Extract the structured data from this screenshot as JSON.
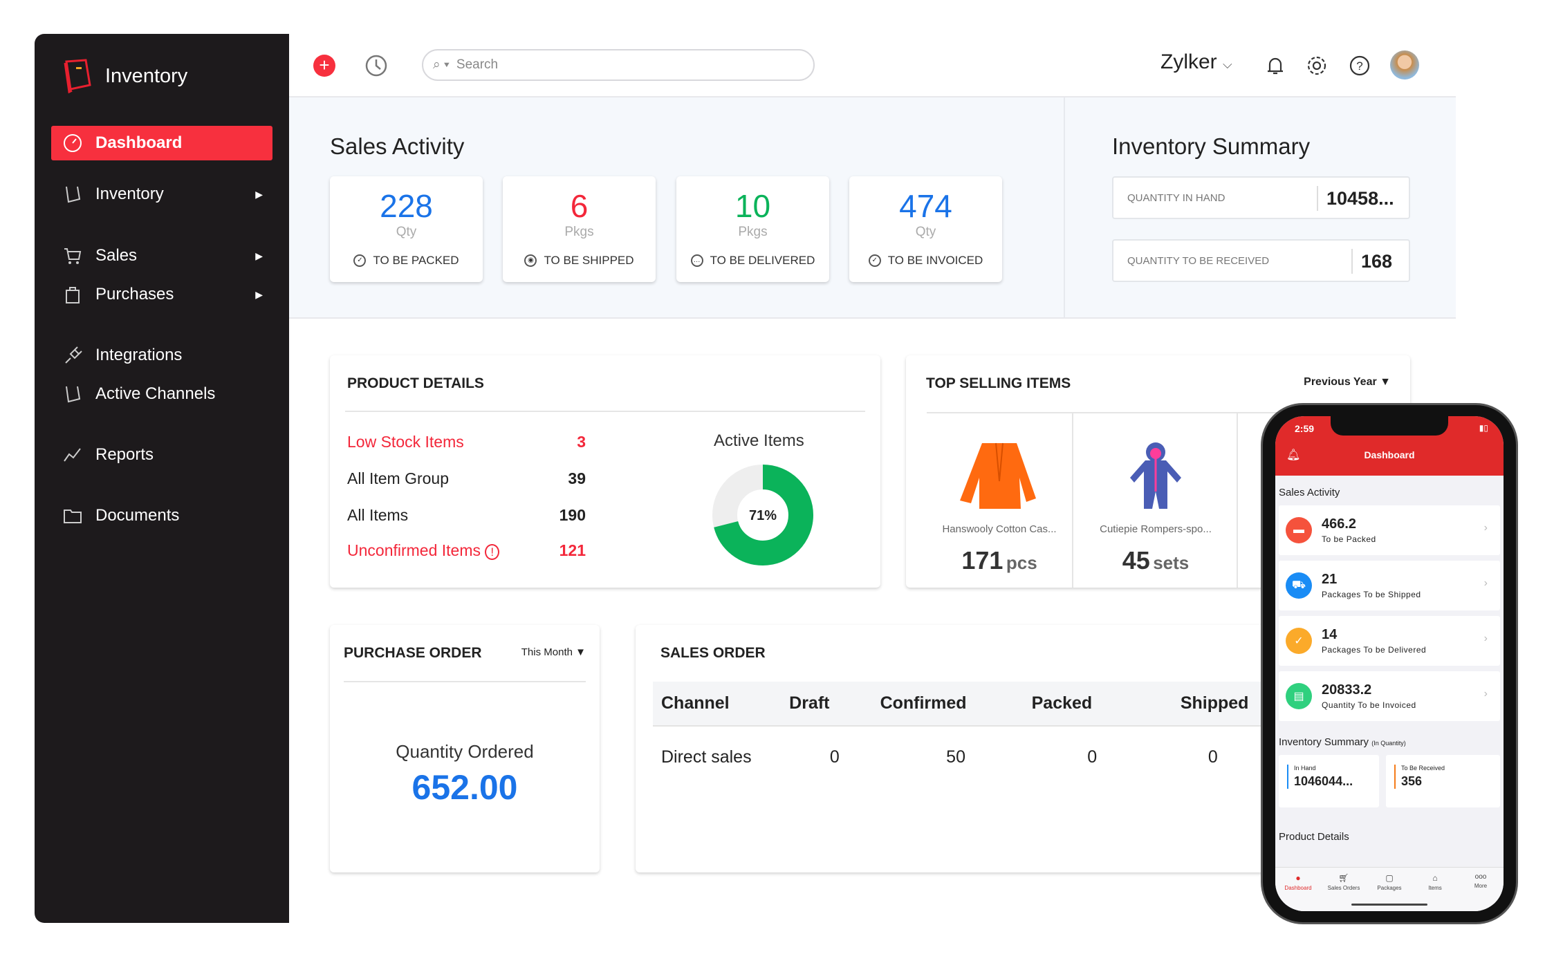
{
  "colors": {
    "brand": "#f7303e",
    "sidebar": "#1d1a1c",
    "blue": "#1a73e8",
    "green": "#0bb35a",
    "red": "#f3273a"
  },
  "app": {
    "name": "Inventory"
  },
  "sidebar": {
    "items": [
      {
        "label": "Dashboard",
        "icon": "dashboard-icon",
        "active": true
      },
      {
        "label": "Inventory",
        "icon": "inventory-icon",
        "has_submenu": true
      },
      {
        "label": "Sales",
        "icon": "cart-icon",
        "has_submenu": true
      },
      {
        "label": "Purchases",
        "icon": "bag-icon",
        "has_submenu": true
      },
      {
        "label": "Integrations",
        "icon": "plug-icon"
      },
      {
        "label": "Active Channels",
        "icon": "channels-icon"
      },
      {
        "label": "Reports",
        "icon": "reports-icon"
      },
      {
        "label": "Documents",
        "icon": "folder-icon"
      }
    ]
  },
  "header": {
    "search_placeholder": "Search",
    "org": "Zylker"
  },
  "sales_activity": {
    "title": "Sales Activity",
    "cards": [
      {
        "value": "228",
        "unit": "Qty",
        "label": "TO BE PACKED",
        "color": "#1a73e8"
      },
      {
        "value": "6",
        "unit": "Pkgs",
        "label": "TO BE SHIPPED",
        "color": "#f3273a"
      },
      {
        "value": "10",
        "unit": "Pkgs",
        "label": "TO BE DELIVERED",
        "color": "#0bb35a"
      },
      {
        "value": "474",
        "unit": "Qty",
        "label": "TO BE INVOICED",
        "color": "#1a73e8"
      }
    ]
  },
  "inventory_summary": {
    "title": "Inventory Summary",
    "rows": [
      {
        "label": "QUANTITY IN HAND",
        "value": "10458..."
      },
      {
        "label": "QUANTITY TO BE RECEIVED",
        "value": "168"
      }
    ]
  },
  "product_details": {
    "title": "PRODUCT DETAILS",
    "rows": [
      {
        "label": "Low Stock Items",
        "value": "3",
        "alert": true
      },
      {
        "label": "All Item Group",
        "value": "39"
      },
      {
        "label": "All Items",
        "value": "190"
      },
      {
        "label": "Unconfirmed Items",
        "value": "121",
        "alert": true
      }
    ],
    "chart_title": "Active Items",
    "active_percent": 71,
    "active_label": "71%"
  },
  "top_selling": {
    "title": "TOP SELLING ITEMS",
    "period": "Previous Year",
    "items": [
      {
        "name": "Hanswooly Cotton Cas...",
        "qty": "171",
        "unit": "pcs"
      },
      {
        "name": "Cutiepie Rompers-spo...",
        "qty": "45",
        "unit": "sets"
      }
    ]
  },
  "purchase_order": {
    "title": "PURCHASE ORDER",
    "period": "This Month",
    "label": "Quantity Ordered",
    "value": "652.00"
  },
  "sales_order": {
    "title": "SALES ORDER",
    "columns": [
      "Channel",
      "Draft",
      "Confirmed",
      "Packed",
      "Shipped"
    ],
    "rows": [
      [
        "Direct sales",
        "0",
        "50",
        "0",
        "0"
      ]
    ]
  },
  "phone": {
    "time": "2:59",
    "title": "Dashboard",
    "sales_activity": "Sales Activity",
    "cards": [
      {
        "value": "466.2",
        "label": "To be Packed",
        "color": "#f5523c"
      },
      {
        "value": "21",
        "label": "Packages To be Shipped",
        "color": "#1a8cf5"
      },
      {
        "value": "14",
        "label": "Packages To be Delivered",
        "color": "#fbaa2a"
      },
      {
        "value": "20833.2",
        "label": "Quantity To be Invoiced",
        "color": "#2fd07e"
      }
    ],
    "inv_title": "Inventory Summary",
    "inv_sub": "(In Quantity)",
    "in_hand_label": "In Hand",
    "in_hand": "1046044...",
    "to_receive_label": "To Be Received",
    "to_receive": "356",
    "product_details": "Product Details",
    "tabs": [
      "Dashboard",
      "Sales Orders",
      "Packages",
      "Items",
      "More"
    ]
  }
}
